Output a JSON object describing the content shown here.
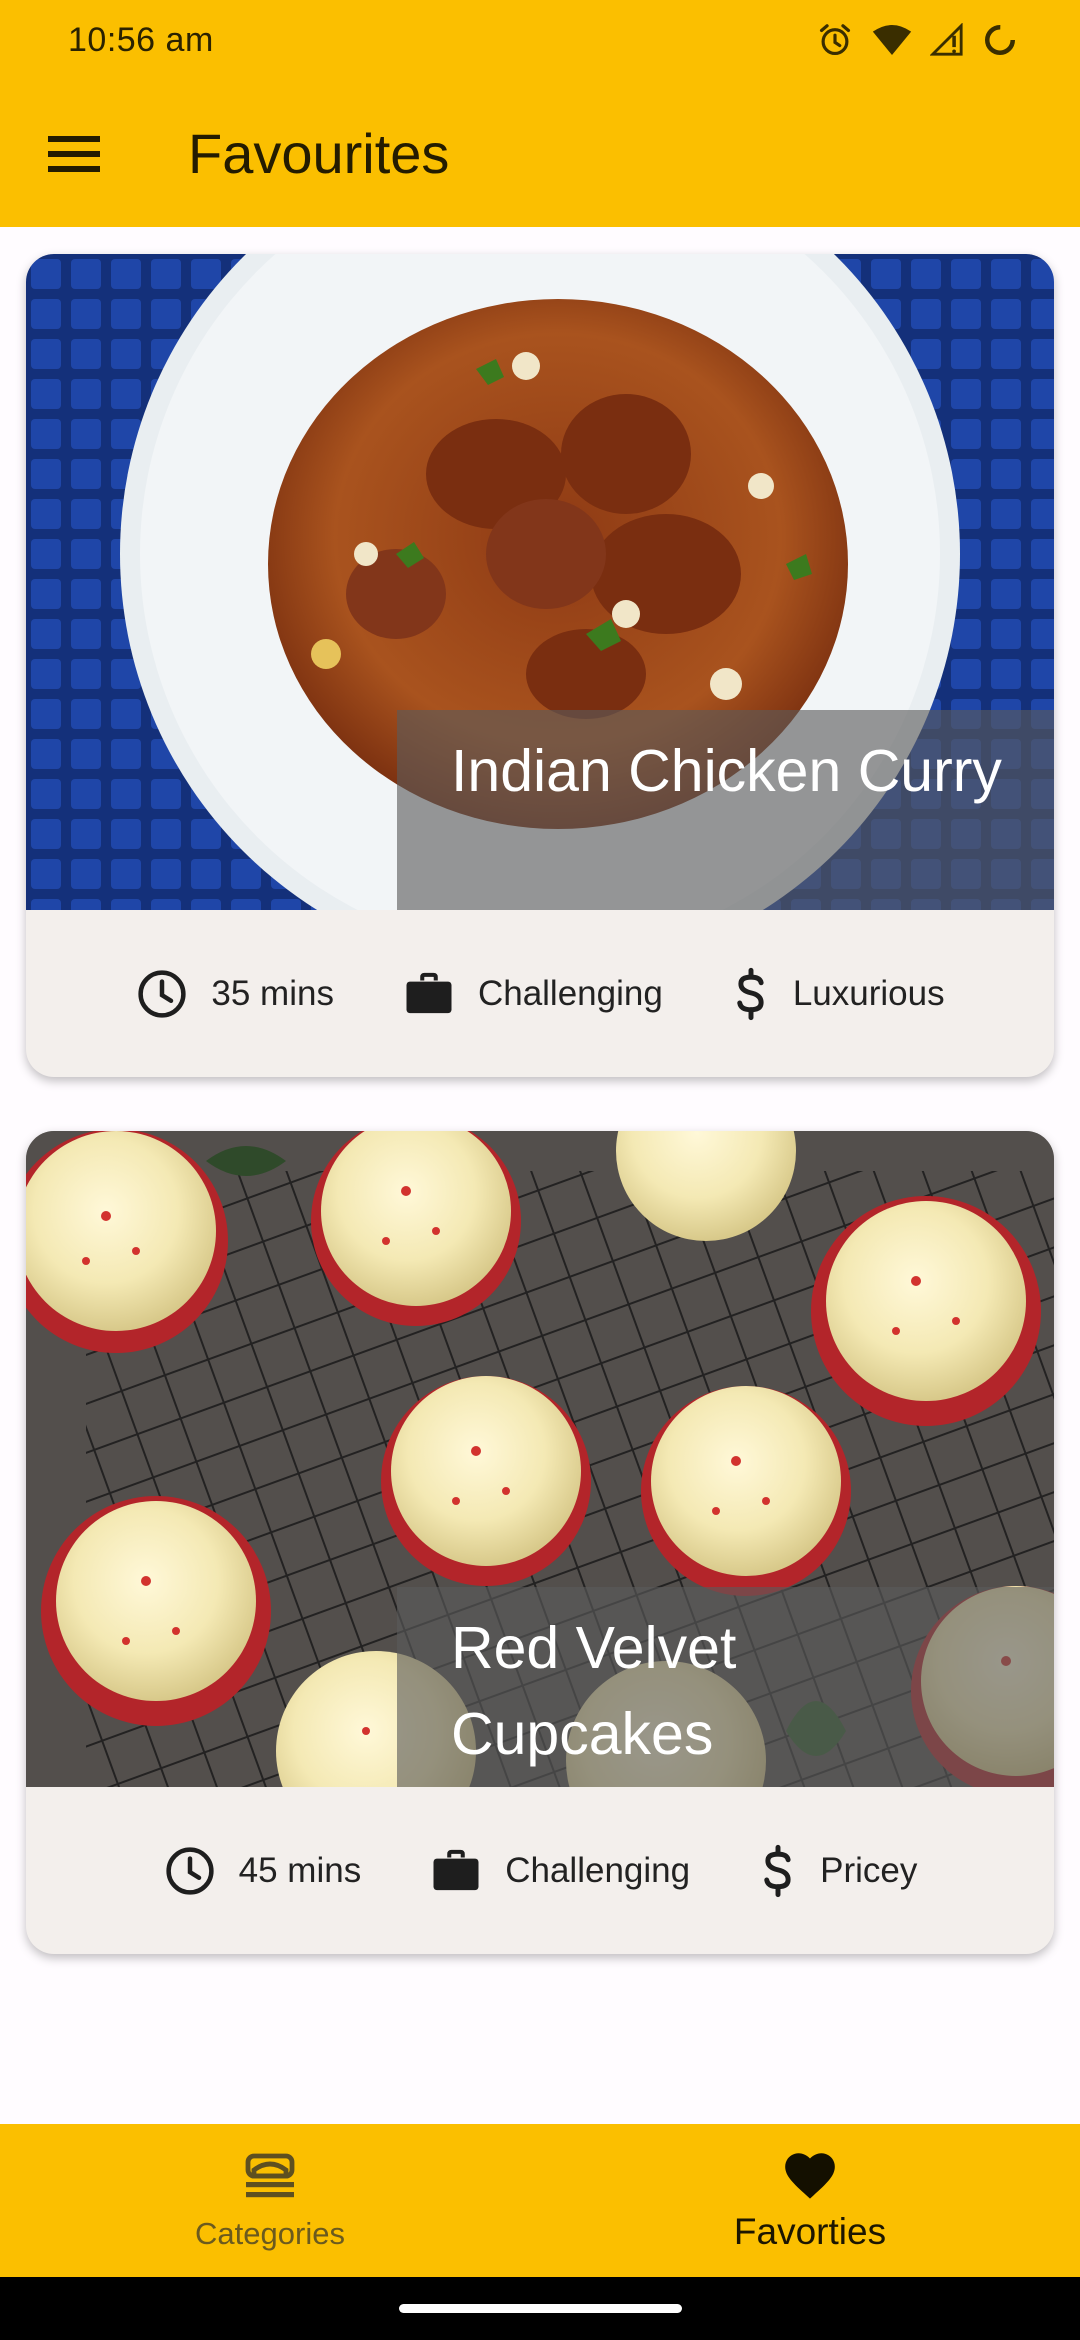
{
  "status_bar": {
    "time": "10:56 am",
    "icons": [
      "alarm-icon",
      "wifi-icon",
      "signal-icon",
      "battery-icon"
    ]
  },
  "app_bar": {
    "title": "Favourites",
    "menu_icon": "menu-icon"
  },
  "meals": [
    {
      "title": "Indian Chicken Curry",
      "duration": "35 mins",
      "complexity": "Challenging",
      "affordability": "Luxurious"
    },
    {
      "title": "Red Velvet Cupcakes",
      "duration": "45 mins",
      "complexity": "Challenging",
      "affordability": "Pricey"
    }
  ],
  "bottom_nav": {
    "items": [
      {
        "label": "Categories",
        "icon": "categories-icon",
        "active": false
      },
      {
        "label": "Favorties",
        "icon": "heart-icon",
        "active": true
      }
    ]
  },
  "colors": {
    "app_bar": "#FBBF00",
    "card_background": "#F3EFEC",
    "page_background": "#FFFCFF"
  }
}
